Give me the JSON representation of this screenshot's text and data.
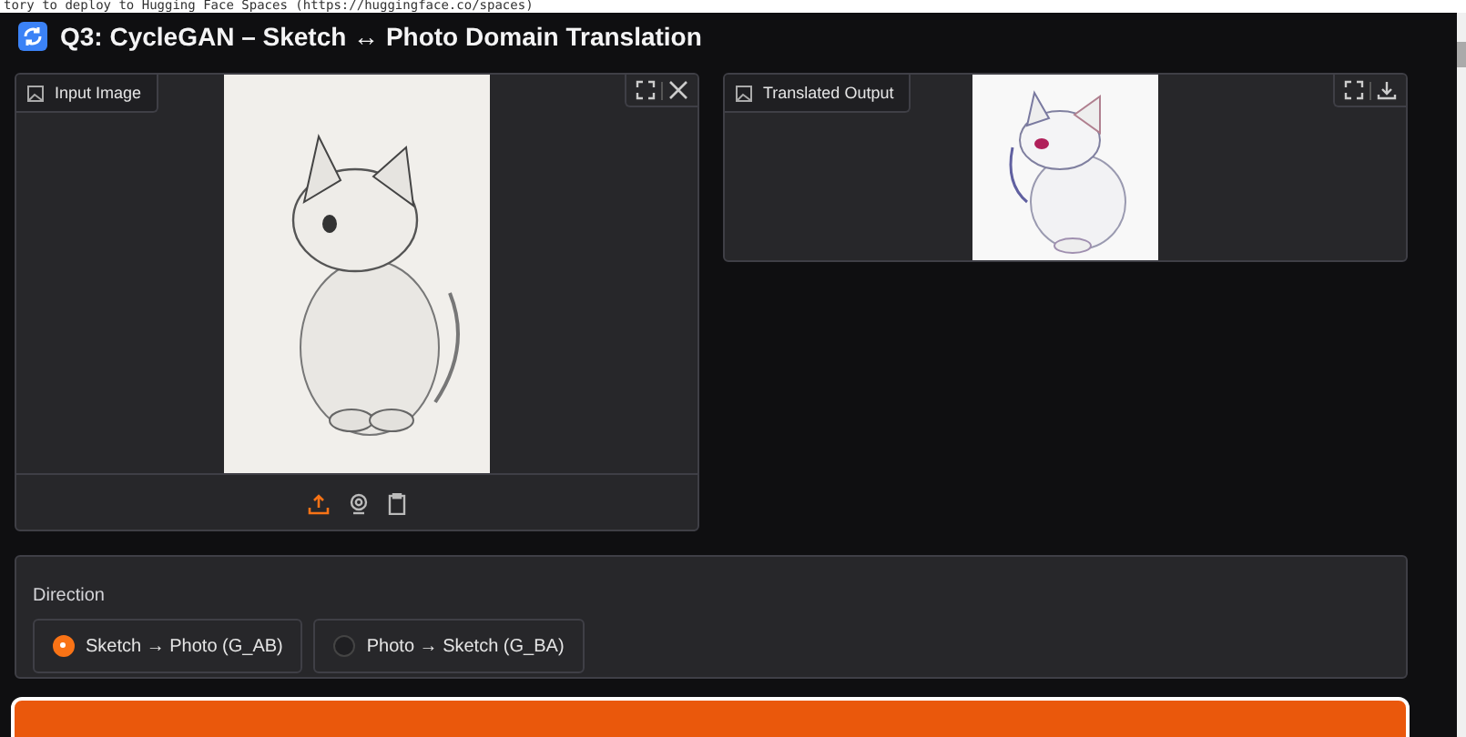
{
  "top_note": "tory to deploy to Hugging Face Spaces (https://huggingface.co/spaces)",
  "title": "Q3: CycleGAN – Sketch ↔ Photo Domain Translation",
  "input_panel": {
    "label": "Input Image"
  },
  "output_panel": {
    "label": "Translated Output"
  },
  "direction": {
    "label": "Direction",
    "options": [
      {
        "label": "Sketch → Photo (G_AB)",
        "selected": true
      },
      {
        "label": "Photo → Sketch (G_BA)",
        "selected": false
      }
    ]
  },
  "submit_button": {
    "kind": "primary"
  }
}
